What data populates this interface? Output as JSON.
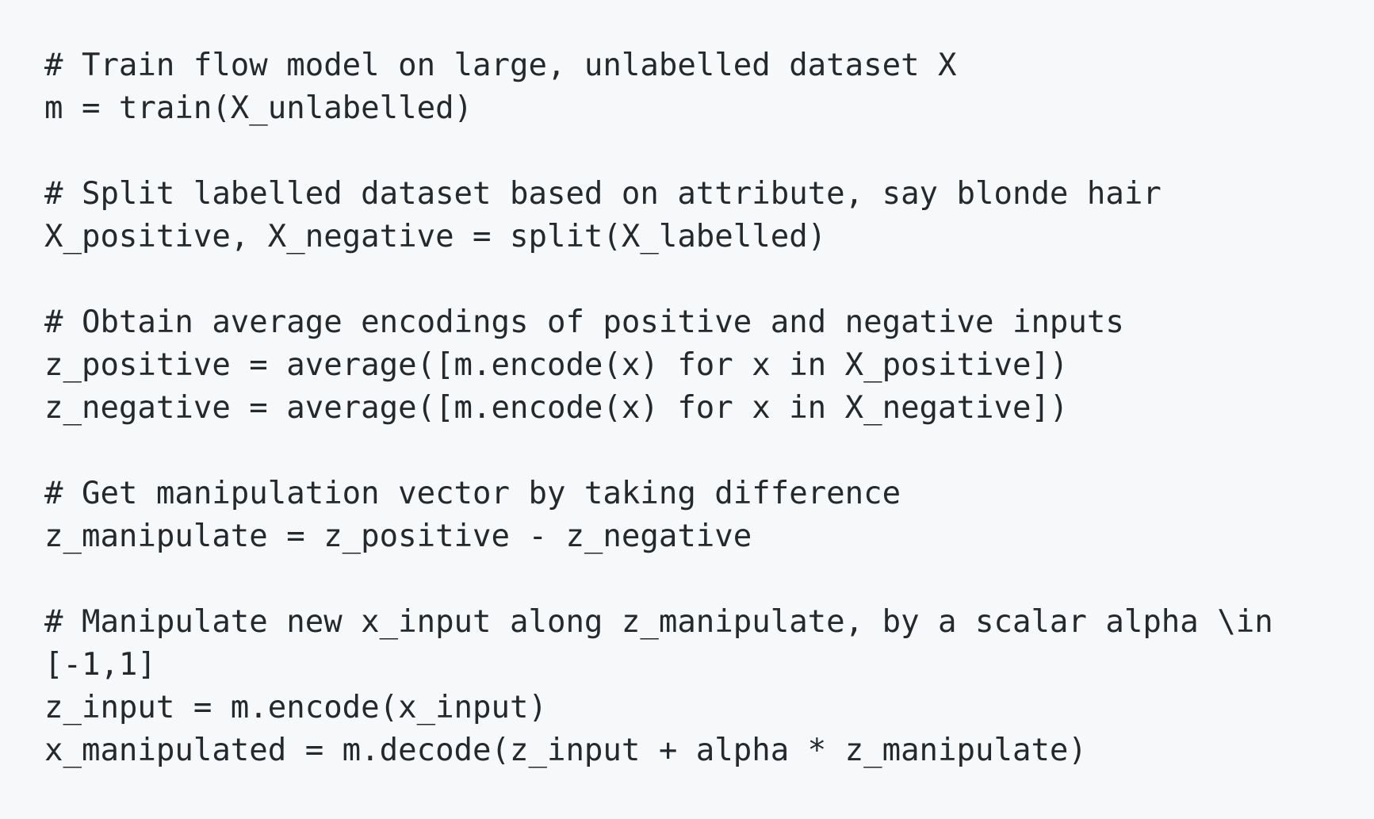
{
  "code": {
    "lines": [
      "# Train flow model on large, unlabelled dataset X",
      "m = train(X_unlabelled)",
      "",
      "# Split labelled dataset based on attribute, say blonde hair",
      "X_positive, X_negative = split(X_labelled)",
      "",
      "# Obtain average encodings of positive and negative inputs",
      "z_positive = average([m.encode(x) for x in X_positive])",
      "z_negative = average([m.encode(x) for x in X_negative])",
      "",
      "# Get manipulation vector by taking difference",
      "z_manipulate = z_positive - z_negative",
      "",
      "# Manipulate new x_input along z_manipulate, by a scalar alpha \\in",
      "[-1,1]",
      "z_input = m.encode(x_input)",
      "x_manipulated = m.decode(z_input + alpha * z_manipulate)"
    ]
  }
}
